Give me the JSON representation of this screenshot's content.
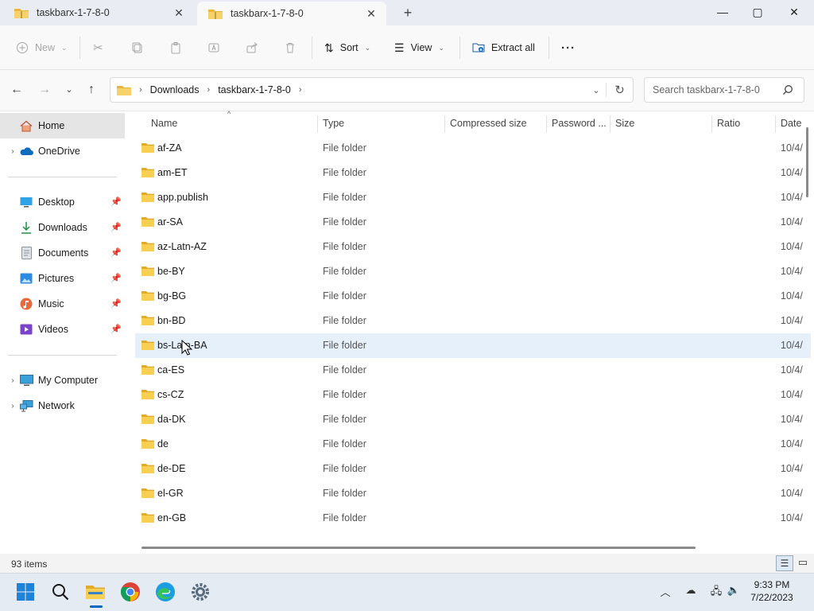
{
  "tabs": [
    {
      "label": "taskbarx-1-7-8-0",
      "active": false
    },
    {
      "label": "taskbarx-1-7-8-0",
      "active": true
    }
  ],
  "window_controls": {
    "minimize": "—",
    "maximize": "▢",
    "close": "✕"
  },
  "toolbar": {
    "new_label": "New",
    "sort_label": "Sort",
    "view_label": "View",
    "extract_label": "Extract all",
    "more_label": "···"
  },
  "address": {
    "crumbs": [
      "Downloads",
      "taskbarx-1-7-8-0"
    ],
    "search_placeholder": "Search taskbarx-1-7-8-0"
  },
  "nav": {
    "home": "Home",
    "onedrive": "OneDrive",
    "quick": [
      "Desktop",
      "Downloads",
      "Documents",
      "Pictures",
      "Music",
      "Videos"
    ],
    "my_computer": "My Computer",
    "network": "Network"
  },
  "columns": [
    "Name",
    "Type",
    "Compressed size",
    "Password ...",
    "Size",
    "Ratio",
    "Date"
  ],
  "rows": [
    {
      "name": "af-ZA",
      "type": "File folder",
      "date": "10/4/"
    },
    {
      "name": "am-ET",
      "type": "File folder",
      "date": "10/4/"
    },
    {
      "name": "app.publish",
      "type": "File folder",
      "date": "10/4/"
    },
    {
      "name": "ar-SA",
      "type": "File folder",
      "date": "10/4/"
    },
    {
      "name": "az-Latn-AZ",
      "type": "File folder",
      "date": "10/4/"
    },
    {
      "name": "be-BY",
      "type": "File folder",
      "date": "10/4/"
    },
    {
      "name": "bg-BG",
      "type": "File folder",
      "date": "10/4/"
    },
    {
      "name": "bn-BD",
      "type": "File folder",
      "date": "10/4/"
    },
    {
      "name": "bs-Latn-BA",
      "type": "File folder",
      "date": "10/4/"
    },
    {
      "name": "ca-ES",
      "type": "File folder",
      "date": "10/4/"
    },
    {
      "name": "cs-CZ",
      "type": "File folder",
      "date": "10/4/"
    },
    {
      "name": "da-DK",
      "type": "File folder",
      "date": "10/4/"
    },
    {
      "name": "de",
      "type": "File folder",
      "date": "10/4/"
    },
    {
      "name": "de-DE",
      "type": "File folder",
      "date": "10/4/"
    },
    {
      "name": "el-GR",
      "type": "File folder",
      "date": "10/4/"
    },
    {
      "name": "en-GB",
      "type": "File folder",
      "date": "10/4/"
    }
  ],
  "selected_row_index": 8,
  "status": {
    "item_count": "93 items"
  },
  "clock": {
    "time": "9:33 PM",
    "date": "7/22/2023"
  },
  "colors": {
    "accent": "#0067c0",
    "folder": "#f4c542",
    "selection": "#e6f0fb"
  }
}
